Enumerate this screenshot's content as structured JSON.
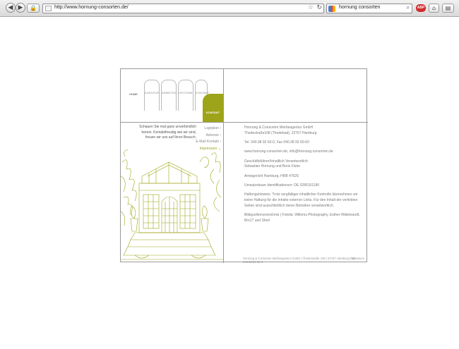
{
  "browser": {
    "url": "http://www.hornung-consorten.de/",
    "search_query": "hornung consorten",
    "abp_label": "ABP"
  },
  "nav": {
    "home": "HOME",
    "tabs": [
      "AGENTUR",
      "ARBEITEN",
      "HISTORIE",
      "KONTAKT"
    ],
    "active": "KONTAKT"
  },
  "intro": "Schauen Sie mal ganz unverbindlich herein. Kontaktfreudig wie wir sind, freuen wir uns auf Ihren Besuch.",
  "submenu": [
    {
      "label": "Lageplan",
      "active": false
    },
    {
      "label": "Adresse",
      "active": false
    },
    {
      "label": "E-Mail Kontakt",
      "active": false
    },
    {
      "label": "Impressum",
      "active": true
    }
  ],
  "content": {
    "company": "Hornung & Consorten Werbeagentur GmbH",
    "street": "Thedestraße108 (Thedebad), 22767 Hamburg",
    "phone": "Tel. 040.38 92 60-0, Fax 040.38 92 60-60",
    "web": "www.hornung-consorten.de, info@hornung-consorten.de",
    "gf_label": "Geschäftsführer/Inhaltlich Verantwortlich:",
    "gf_names": "Sebastian Hornung und Boris Fister",
    "court": "Amtsgericht Hamburg, HRB 47626",
    "vat": "Umsatzsteuer-Identifikationsnr: DE 0285101190",
    "disclaimer": "Haftungshinweis: Trotz sorgfältiger inhaltlicher Kontrolle übernehmen wir keine Haftung für die Inhalte externer Links. Für den Inhalt der verlinkten Seiten sind ausschließlich deren Betreiber verantwortlich.",
    "credits": "Bildquellenverzeichnis | Fotolia: Willems Photography, Esther Hildebrandt, Bro17 und Sherl"
  },
  "footer": {
    "left": "Hornung & Consorten Werbeagentur GmbH | Thedestraße 108 | 22767 Hamburg | Tel. 040.38 92 60-0",
    "right": "Impressum"
  },
  "colors": {
    "accent": "#9da419"
  },
  "icons": [
    "back-arrow-icon",
    "forward-arrow-icon",
    "lock-icon",
    "page-icon",
    "star-icon",
    "reload-icon",
    "search-icon",
    "home-icon",
    "bookmarks-icon"
  ]
}
